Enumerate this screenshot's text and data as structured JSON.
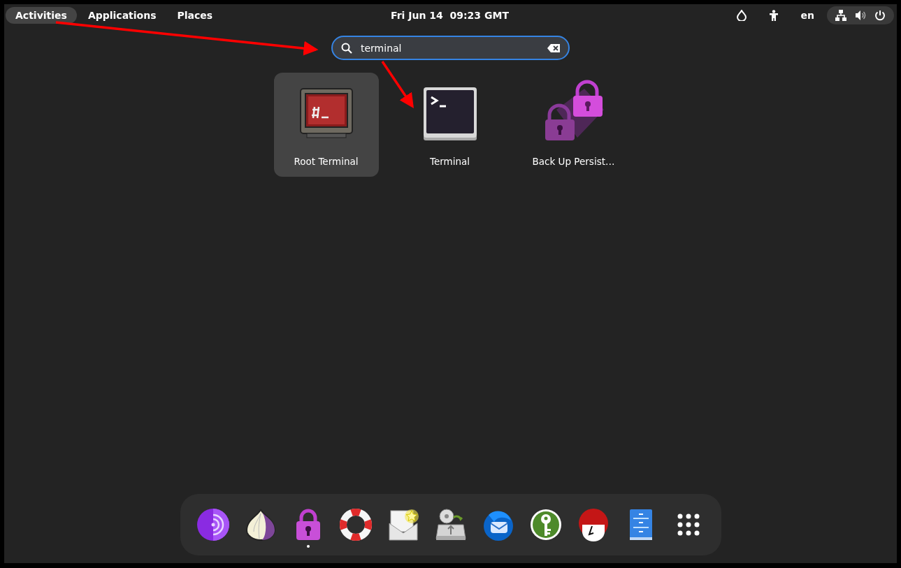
{
  "top_bar": {
    "activities": {
      "label": "Activities",
      "active": true
    },
    "menus": [
      "Applications",
      "Places"
    ],
    "clock": "Fri Jun 14  09:23 GMT",
    "language": "en"
  },
  "search": {
    "value": "terminal"
  },
  "results": [
    {
      "label": "Root Terminal",
      "kind": "root-terminal",
      "selected": true
    },
    {
      "label": "Terminal",
      "kind": "terminal",
      "selected": false
    },
    {
      "label": "Back Up Persist…",
      "kind": "backup",
      "selected": false
    }
  ],
  "dock": [
    {
      "kind": "tor-browser",
      "running": false
    },
    {
      "kind": "onion",
      "running": false
    },
    {
      "kind": "padlock",
      "running": true
    },
    {
      "kind": "lifebuoy",
      "running": false
    },
    {
      "kind": "mail",
      "running": false
    },
    {
      "kind": "drive",
      "running": false
    },
    {
      "kind": "thunderbird",
      "running": false
    },
    {
      "kind": "keepass",
      "running": false
    },
    {
      "kind": "red-hair",
      "running": false
    },
    {
      "kind": "files",
      "running": false
    },
    {
      "kind": "app-grid",
      "running": false
    }
  ]
}
